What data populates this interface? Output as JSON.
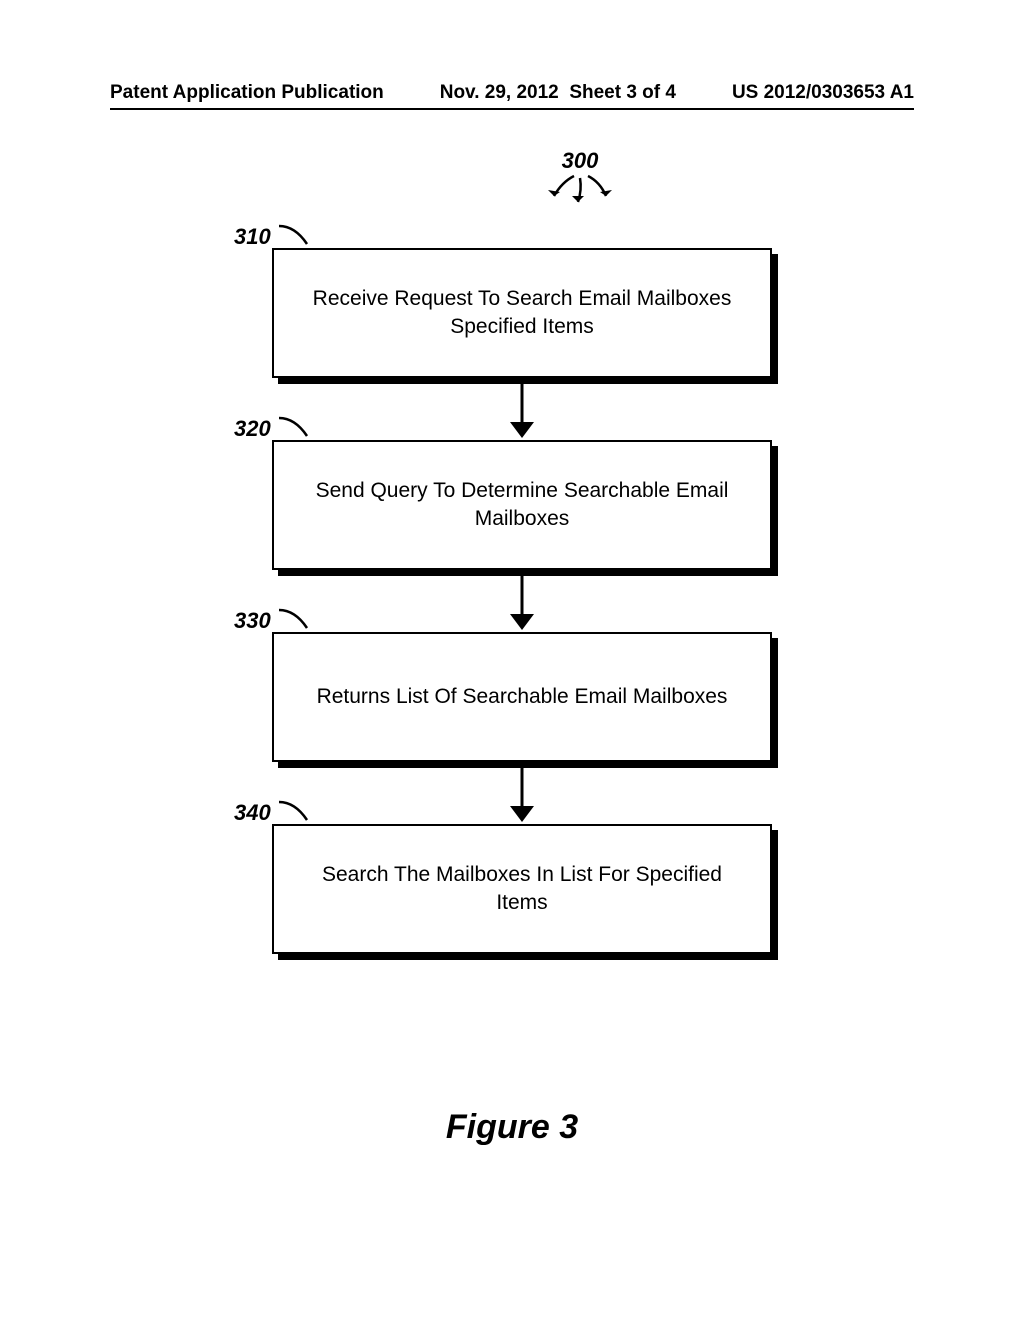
{
  "header": {
    "pub_type": "Patent Application Publication",
    "pub_date": "Nov. 29, 2012",
    "sheet": "Sheet 3 of 4",
    "pub_number": "US 2012/0303653 A1"
  },
  "diagram": {
    "ref": "300",
    "figure_caption": "Figure 3",
    "steps": [
      {
        "ref": "310",
        "text": "Receive Request To Search Email Mailboxes Specified Items"
      },
      {
        "ref": "320",
        "text": "Send Query To Determine Searchable Email Mailboxes"
      },
      {
        "ref": "330",
        "text": "Returns List Of Searchable Email Mailboxes"
      },
      {
        "ref": "340",
        "text": "Search The Mailboxes In List For Specified Items"
      }
    ]
  }
}
